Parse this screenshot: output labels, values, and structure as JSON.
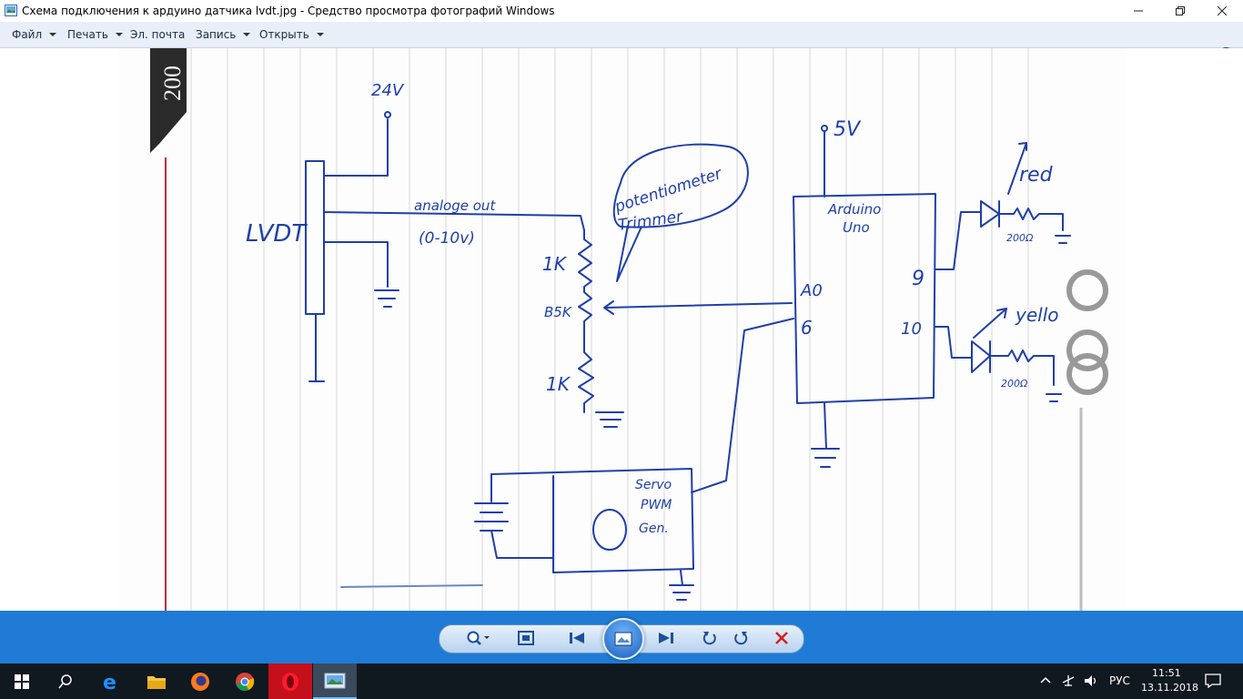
{
  "window": {
    "title": "Схема подключения к ардуино датчика lvdt.jpg - Средство просмотра фотографий Windows",
    "icons": {
      "app": "photo-viewer-icon",
      "minimize": "minimize-icon",
      "restore": "restore-icon",
      "close": "close-icon"
    }
  },
  "menu": {
    "items": [
      {
        "label": "Файл",
        "has_dropdown": true
      },
      {
        "label": "Печать",
        "has_dropdown": true
      },
      {
        "label": "Эл. почта",
        "has_dropdown": false
      },
      {
        "label": "Запись",
        "has_dropdown": true
      },
      {
        "label": "Открыть",
        "has_dropdown": true
      }
    ],
    "help_label": "?"
  },
  "photo": {
    "notebook_stamp": "200",
    "labels": {
      "supply_24v": "24V",
      "lvdt": "LVDT",
      "analog_out": "analoge out",
      "range": "(0-10v)",
      "bubble": "potentiometer",
      "trimmer": "Trimmer",
      "r_top": "1K",
      "r_trim": "B5K",
      "r_bottom": "1K",
      "supply_5v": "5V",
      "arduino_line1": "Arduino",
      "arduino_line2": "Uno",
      "pin_a0": "A0",
      "pin_6": "6",
      "pin_9": "9",
      "pin_10": "10",
      "led_red": "red",
      "led_yellow": "yello",
      "res_red": "200Ω",
      "res_yellow": "200Ω",
      "servo_line1": "Servo",
      "servo_line2": "PWM",
      "servo_line3": "Gen."
    },
    "ink_color": "#1f3fa8"
  },
  "controls": {
    "icons": [
      "zoom-icon",
      "fit-window-icon",
      "previous-icon",
      "slideshow-icon",
      "next-icon",
      "rotate-left-icon",
      "rotate-right-icon",
      "delete-icon"
    ],
    "accent": "#1f7bd6"
  },
  "taskbar": {
    "apps": [
      "start-icon",
      "search-icon",
      "edge-icon",
      "file-explorer-icon",
      "firefox-icon",
      "chrome-icon",
      "opera-icon",
      "photo-viewer-icon"
    ],
    "language": "РУС",
    "time": "11:51",
    "date": "13.11.2018"
  }
}
